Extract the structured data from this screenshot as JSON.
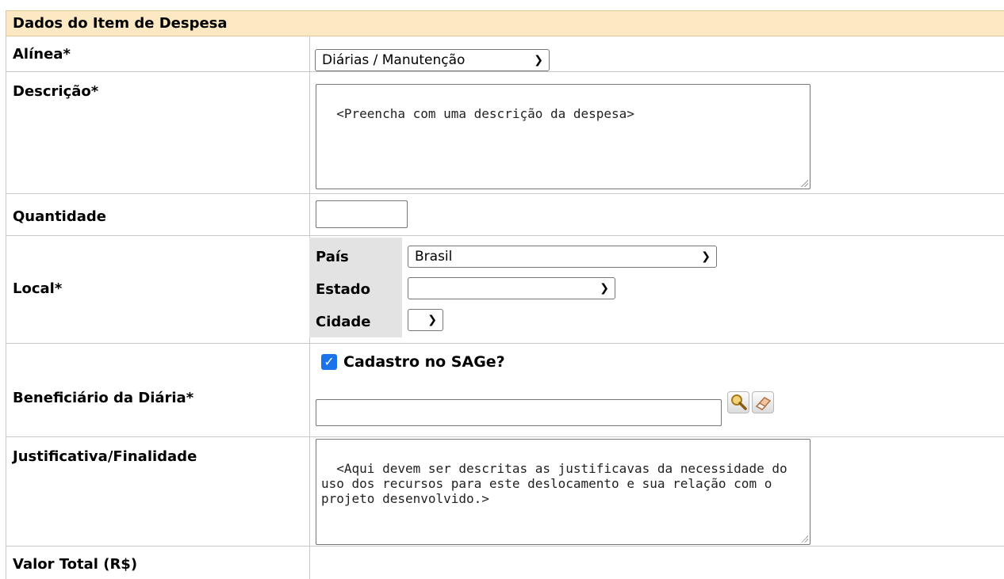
{
  "section": {
    "title": "Dados do Item de Despesa"
  },
  "fields": {
    "alinea": {
      "label": "Alínea*",
      "value": "Diárias / Manutenção"
    },
    "descricao": {
      "label": "Descrição*",
      "value": "<Preencha com uma descrição da despesa>"
    },
    "quantidade": {
      "label": "Quantidade",
      "value": ""
    },
    "local": {
      "label": "Local*",
      "pais_label": "País",
      "pais_value": "Brasil",
      "estado_label": "Estado",
      "estado_value": "",
      "cidade_label": "Cidade",
      "cidade_value": ""
    },
    "beneficiario": {
      "label": "Beneficiário da Diária*",
      "checkbox_label": "Cadastro no SAGe?",
      "checked": true,
      "value": ""
    },
    "justificativa": {
      "label": "Justificativa/Finalidade",
      "value": "<Aqui devem ser descritas as justificavas da necessidade do uso dos recursos para este deslocamento e sua relação com o projeto desenvolvido.>"
    },
    "valor_total": {
      "label": "Valor Total (R$)"
    }
  },
  "icons": {
    "search": "magnifier-icon",
    "clear": "eraser-icon",
    "chevron": "chevron-down-icon"
  }
}
